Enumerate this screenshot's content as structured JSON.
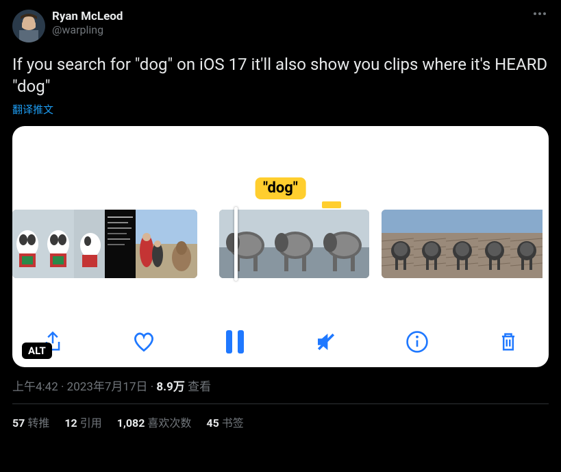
{
  "user": {
    "display_name": "Ryan McLeod",
    "handle": "@warpling"
  },
  "tweet_text": "If you search for \"dog\" on iOS 17 it'll also show you clips where it's HEARD \"dog\"",
  "translate_label": "翻译推文",
  "media": {
    "tooltip_text": "\"dog\"",
    "alt_badge": "ALT"
  },
  "meta": {
    "time": "上午4:42",
    "sep1": " · ",
    "date": "2023年7月17日",
    "sep2": " · ",
    "views_count": "8.9万",
    "views_label": " 查看"
  },
  "stats": {
    "retweets_count": "57",
    "retweets_label": "转推",
    "quotes_count": "12",
    "quotes_label": "引用",
    "likes_count": "1,082",
    "likes_label": "喜欢次数",
    "bookmarks_count": "45",
    "bookmarks_label": "书签"
  }
}
